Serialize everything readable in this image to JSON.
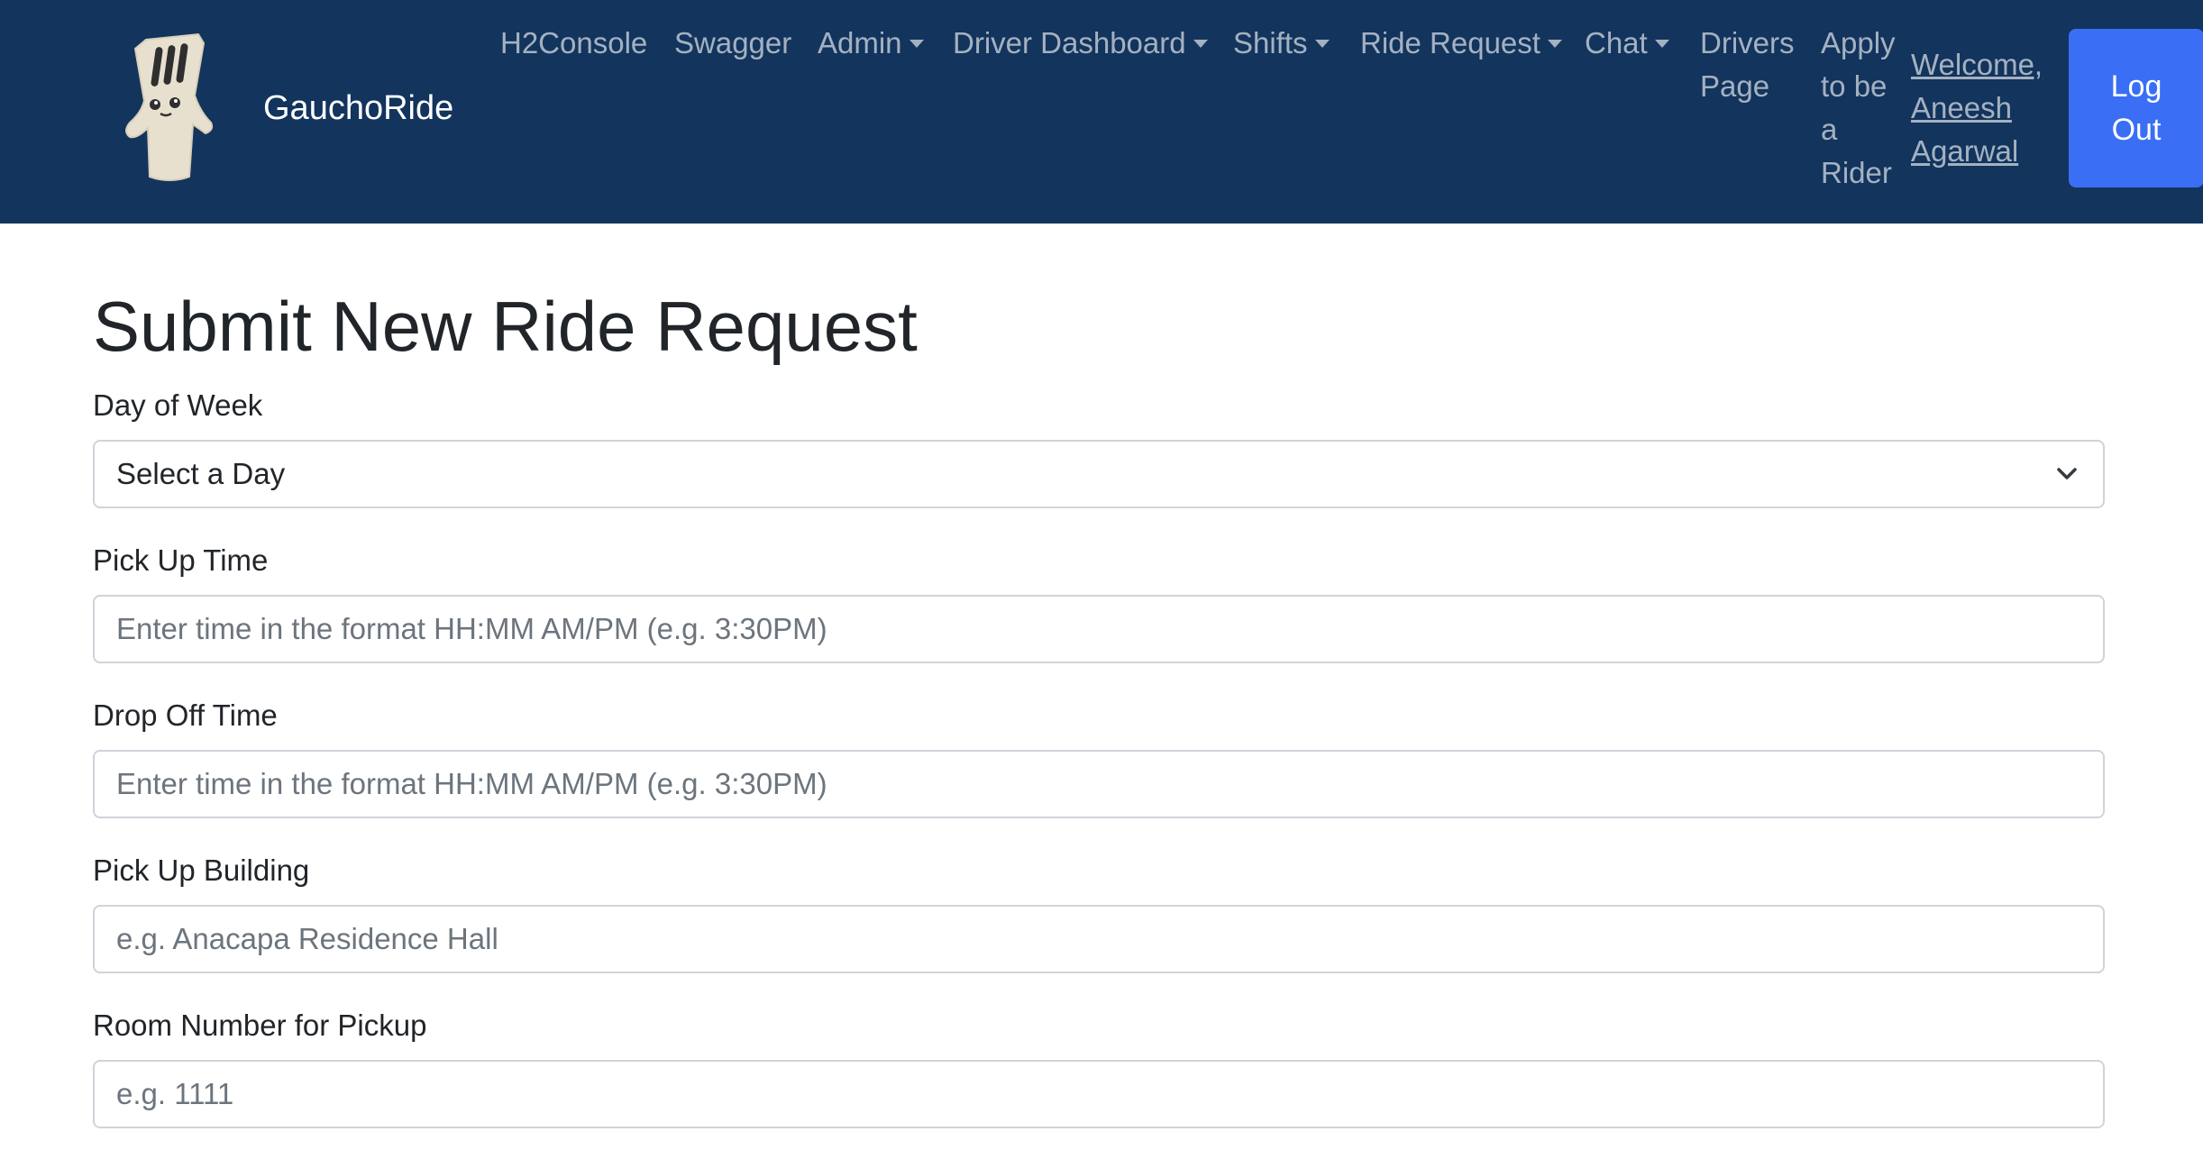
{
  "brand": {
    "name": "GauchoRide",
    "logo_icon": "gaucho-fork-mascot"
  },
  "nav": {
    "h2console": "H2Console",
    "swagger": "Swagger",
    "admin": "Admin",
    "driver_dashboard": "Driver Dashboard",
    "shifts": "Shifts",
    "ride_request": "Ride Request",
    "chat": "Chat",
    "drivers_page": [
      "Drivers",
      "Page"
    ],
    "apply_rider": [
      "Apply",
      "to be",
      "a",
      "Rider"
    ],
    "welcome": [
      "Welcome,",
      "Aneesh",
      "Agarwal"
    ],
    "logout": [
      "Log",
      "Out"
    ]
  },
  "form": {
    "title": "Submit New Ride Request",
    "day_of_week": {
      "label": "Day of Week",
      "selected": "Select a Day"
    },
    "pickup_time": {
      "label": "Pick Up Time",
      "placeholder": "Enter time in the format HH:MM AM/PM (e.g. 3:30PM)"
    },
    "dropoff_time": {
      "label": "Drop Off Time",
      "placeholder": "Enter time in the format HH:MM AM/PM (e.g. 3:30PM)"
    },
    "pickup_building": {
      "label": "Pick Up Building",
      "placeholder": "e.g. Anacapa Residence Hall"
    },
    "pickup_room": {
      "label": "Room Number for Pickup",
      "placeholder": "e.g. 1111"
    }
  },
  "colors": {
    "navbar_bg": "#12345d",
    "logout_bg": "#3a6ff5",
    "nav_text": "rgba(255,255,255,0.62)"
  }
}
